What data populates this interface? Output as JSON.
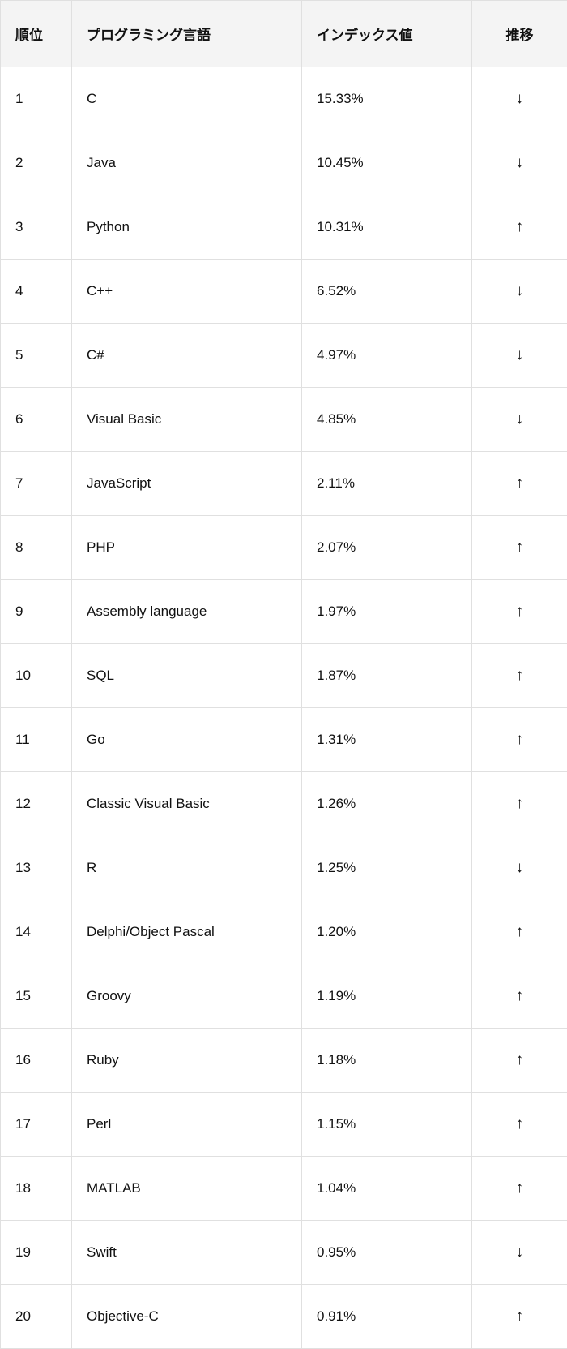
{
  "chart_data": {
    "type": "table",
    "title": "",
    "columns": [
      "順位",
      "プログラミング言語",
      "インデックス値",
      "推移"
    ],
    "rows": [
      {
        "rank": "1",
        "language": "C",
        "index": "15.33%",
        "trend": "↓"
      },
      {
        "rank": "2",
        "language": "Java",
        "index": "10.45%",
        "trend": "↓"
      },
      {
        "rank": "3",
        "language": "Python",
        "index": "10.31%",
        "trend": "↑"
      },
      {
        "rank": "4",
        "language": "C++",
        "index": "6.52%",
        "trend": "↓"
      },
      {
        "rank": "5",
        "language": "C#",
        "index": "4.97%",
        "trend": "↓"
      },
      {
        "rank": "6",
        "language": "Visual Basic",
        "index": "4.85%",
        "trend": "↓"
      },
      {
        "rank": "7",
        "language": "JavaScript",
        "index": "2.11%",
        "trend": "↑"
      },
      {
        "rank": "8",
        "language": "PHP",
        "index": "2.07%",
        "trend": "↑"
      },
      {
        "rank": "9",
        "language": "Assembly language",
        "index": "1.97%",
        "trend": "↑"
      },
      {
        "rank": "10",
        "language": "SQL",
        "index": "1.87%",
        "trend": "↑"
      },
      {
        "rank": "11",
        "language": "Go",
        "index": "1.31%",
        "trend": "↑"
      },
      {
        "rank": "12",
        "language": "Classic Visual Basic",
        "index": "1.26%",
        "trend": "↑"
      },
      {
        "rank": "13",
        "language": "R",
        "index": "1.25%",
        "trend": "↓"
      },
      {
        "rank": "14",
        "language": "Delphi/Object Pascal",
        "index": "1.20%",
        "trend": "↑"
      },
      {
        "rank": "15",
        "language": "Groovy",
        "index": "1.19%",
        "trend": "↑"
      },
      {
        "rank": "16",
        "language": "Ruby",
        "index": "1.18%",
        "trend": "↑"
      },
      {
        "rank": "17",
        "language": "Perl",
        "index": "1.15%",
        "trend": "↑"
      },
      {
        "rank": "18",
        "language": "MATLAB",
        "index": "1.04%",
        "trend": "↑"
      },
      {
        "rank": "19",
        "language": "Swift",
        "index": "0.95%",
        "trend": "↓"
      },
      {
        "rank": "20",
        "language": "Objective-C",
        "index": "0.91%",
        "trend": "↑"
      }
    ]
  }
}
